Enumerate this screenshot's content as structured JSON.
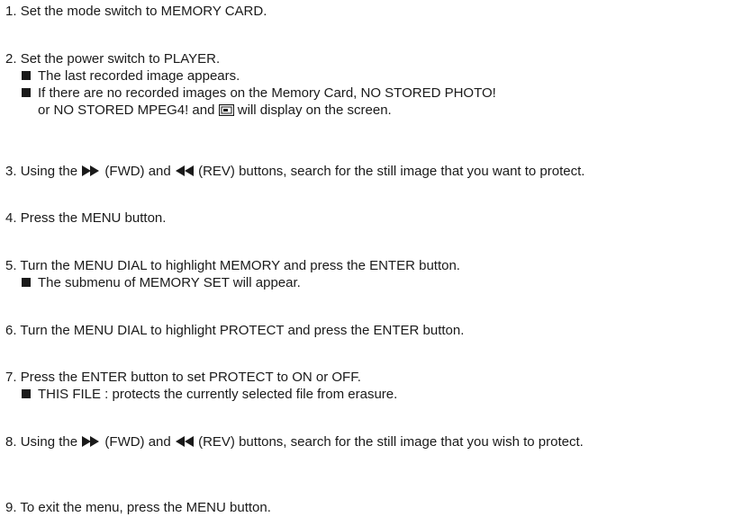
{
  "steps": [
    {
      "num": "1.",
      "text": "Set the mode switch to MEMORY CARD."
    },
    {
      "num": "2.",
      "text": "Set the power switch to PLAYER.",
      "sub": [
        "The last recorded image appears.",
        "If there are no recorded images on the Memory Card, NO STORED PHOTO!"
      ],
      "cont_before": "or NO STORED MPEG4! and",
      "cont_after": "will display on the screen."
    },
    {
      "num": "3.",
      "pre": "Using the",
      "fwd": "(FWD) and",
      "rev": "(REV) buttons, search for the still image that you want to protect."
    },
    {
      "num": "4.",
      "text": "Press the MENU button."
    },
    {
      "num": "5.",
      "text": "Turn the MENU DIAL to highlight MEMORY and press the ENTER button.",
      "sub": [
        "The submenu of MEMORY SET will appear."
      ]
    },
    {
      "num": "6.",
      "text": "Turn the MENU DIAL to highlight PROTECT and press the ENTER button."
    },
    {
      "num": "7.",
      "text": "Press the ENTER button to set PROTECT to ON or OFF.",
      "sub": [
        "THIS FILE : protects the currently selected file from erasure."
      ]
    },
    {
      "num": "8.",
      "pre": "Using the",
      "fwd": "(FWD) and",
      "rev": "(REV) buttons, search for the still image that you wish to protect."
    },
    {
      "num": "9.",
      "text": "To exit the menu, press the MENU button."
    }
  ]
}
